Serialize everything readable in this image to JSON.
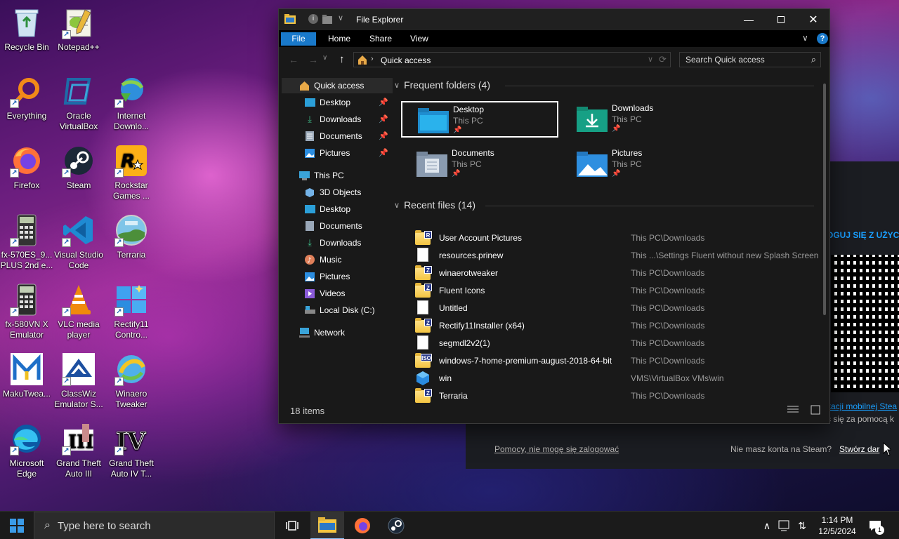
{
  "desktop": {
    "icons": [
      {
        "label": "Recycle Bin",
        "icon": "recycle-bin-icon"
      },
      {
        "label": "Notepad++",
        "icon": "notepad-plus-plus-icon"
      },
      {
        "label": "Everything",
        "icon": "everything-icon"
      },
      {
        "label": "Oracle VirtualBox",
        "icon": "virtualbox-icon"
      },
      {
        "label": "Internet Downlo...",
        "icon": "internet-download-manager-icon"
      },
      {
        "label": "Firefox",
        "icon": "firefox-icon"
      },
      {
        "label": "Steam",
        "icon": "steam-icon"
      },
      {
        "label": "Rockstar Games ...",
        "icon": "rockstar-icon"
      },
      {
        "label": "fx-570ES_9... PLUS 2nd e...",
        "icon": "calculator-icon"
      },
      {
        "label": "Visual Studio Code",
        "icon": "vscode-icon"
      },
      {
        "label": "Terraria",
        "icon": "terraria-icon"
      },
      {
        "label": "fx-580VN X Emulator",
        "icon": "calculator-icon"
      },
      {
        "label": "VLC media player",
        "icon": "vlc-icon"
      },
      {
        "label": "Rectify11 Contro...",
        "icon": "rectify11-icon"
      },
      {
        "label": "MakuTwea...",
        "icon": "makutweaker-icon"
      },
      {
        "label": "ClassWiz Emulator S...",
        "icon": "classwiz-icon"
      },
      {
        "label": "Winaero Tweaker",
        "icon": "winaero-icon"
      },
      {
        "label": "Microsoft Edge",
        "icon": "edge-icon"
      },
      {
        "label": "Grand Theft Auto III",
        "icon": "gta3-icon"
      },
      {
        "label": "Grand Theft Auto IV T...",
        "icon": "gta4-icon"
      }
    ]
  },
  "steam": {
    "login_header": "OGUJ SIĘ Z UŻYCI",
    "mobile_app_text": "kacji mobilnej Stea",
    "mobile_app_text2": "ć się za pomocą k",
    "help_link": "Pomocy, nie mogę się zalogować",
    "no_account_text": "Nie masz konta na Steam?",
    "create_link": "Stwórz dar"
  },
  "explorer": {
    "title": "File Explorer",
    "ribbon_tabs": [
      "File",
      "Home",
      "Share",
      "View"
    ],
    "help_label": "?",
    "address": "Quick access",
    "search_placeholder": "Search Quick access",
    "nav": {
      "quick_access": "Quick access",
      "quick_items": [
        "Desktop",
        "Downloads",
        "Documents",
        "Pictures"
      ],
      "this_pc": "This PC",
      "pc_items": [
        "3D Objects",
        "Desktop",
        "Documents",
        "Downloads",
        "Music",
        "Pictures",
        "Videos",
        "Local Disk (C:)"
      ],
      "network": "Network"
    },
    "frequent_header": "Frequent folders (4)",
    "folders": [
      {
        "name": "Desktop",
        "sub": "This PC"
      },
      {
        "name": "Downloads",
        "sub": "This PC"
      },
      {
        "name": "Documents",
        "sub": "This PC"
      },
      {
        "name": "Pictures",
        "sub": "This PC"
      }
    ],
    "recent_header": "Recent files (14)",
    "recent": [
      {
        "name": "User Account Pictures",
        "path": "This PC\\Downloads",
        "badge": "R"
      },
      {
        "name": "resources.prinew",
        "path": "This ...\\Settings Fluent without new Splash Screen",
        "badge": ""
      },
      {
        "name": "winaerotweaker",
        "path": "This PC\\Downloads",
        "badge": "Z"
      },
      {
        "name": "Fluent Icons",
        "path": "This PC\\Downloads",
        "badge": "Z"
      },
      {
        "name": "Untitled",
        "path": "This PC\\Downloads",
        "badge": ""
      },
      {
        "name": "Rectify11Installer (x64)",
        "path": "This PC\\Downloads",
        "badge": "Z"
      },
      {
        "name": "segmdl2v2(1)",
        "path": "This PC\\Downloads",
        "badge": ""
      },
      {
        "name": "windows-7-home-premium-august-2018-64-bit",
        "path": "This PC\\Downloads",
        "badge": "ISO"
      },
      {
        "name": "win",
        "path": "VMS\\VirtualBox VMs\\win",
        "badge": ""
      },
      {
        "name": "Terraria",
        "path": "This PC\\Downloads",
        "badge": "Z"
      }
    ],
    "status": "18 items"
  },
  "taskbar": {
    "search_placeholder": "Type here to search",
    "time": "1:14 PM",
    "date": "12/5/2024",
    "notification_count": "1"
  },
  "colors": {
    "accent": "#1979ca",
    "steam_link": "#1a9fff"
  }
}
